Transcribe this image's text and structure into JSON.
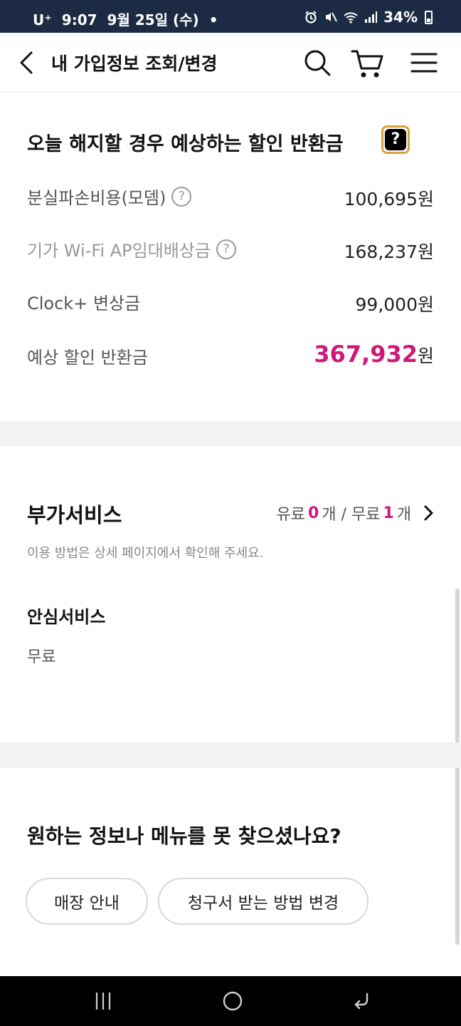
{
  "status_bar": {
    "carrier": "U⁺",
    "time": "9:07",
    "date": "9월 25일 (수)",
    "dot": "•",
    "battery": "34%",
    "icons": [
      "alarm-icon",
      "mute-icon",
      "wifi-icon",
      "signal-icon",
      "battery-icon"
    ]
  },
  "header": {
    "title": "내 가입정보 조회/변경",
    "icons": [
      "back-icon",
      "search-icon",
      "cart-icon",
      "menu-icon"
    ]
  },
  "refund": {
    "title": "오늘 해지할 경우 예상하는 할인 반환금",
    "help_glyph": "?",
    "rows": [
      {
        "label": "분실파손비용(모뎀)",
        "value": "100,695원",
        "has_help": true
      },
      {
        "label": "기가 Wi-Fi AP임대배상금",
        "value": "168,237원",
        "has_help": true
      },
      {
        "label": "Clock+ 변상금",
        "value": "99,000원",
        "has_help": false
      }
    ],
    "total_label": "예상 할인 반환금",
    "total_value": "367,932",
    "total_unit": "원",
    "q_glyph": "?"
  },
  "addon": {
    "title": "부가서비스",
    "paid_label": "유료 ",
    "paid_count": "0",
    "paid_unit": "개 / 무료 ",
    "free_count": "1",
    "free_unit": "개",
    "subtitle": "이용 방법은 상세 페이지에서 확인해 주세요.",
    "service_name": "안심서비스",
    "service_price": "무료"
  },
  "help": {
    "title": "원하는 정보나 메뉴를 못 찾으셨나요?",
    "buttons": [
      "매장 안내",
      "청구서 받는 방법 변경"
    ]
  },
  "colors": {
    "status_bar_bg": "#1c2a44",
    "accent_pink": "#d0177a",
    "divider": "#f1f2f4",
    "help_badge_border": "#d9a13a"
  }
}
